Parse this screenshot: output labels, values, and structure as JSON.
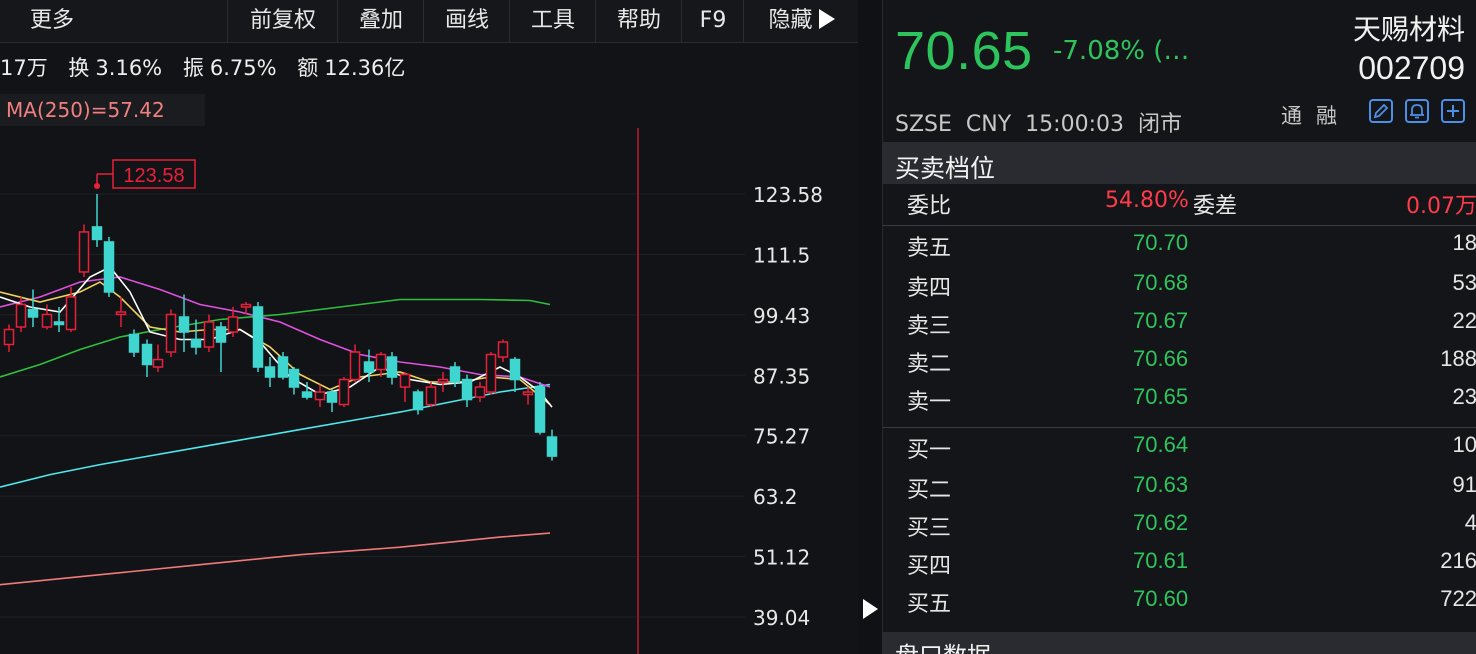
{
  "toolbar": {
    "items": [
      "更多",
      "前复权",
      "叠加",
      "画线",
      "工具",
      "帮助",
      "F9",
      "隐藏"
    ]
  },
  "stats": {
    "volume_value": "17万",
    "turnover_label": "换",
    "turnover_value": "3.16%",
    "amplitude_label": "振",
    "amplitude_value": "6.75%",
    "amount_label": "额",
    "amount_value": "12.36亿"
  },
  "ma_legend": "MA(250)=57.42",
  "chart": {
    "y_ticks": [
      "123.58",
      "111.5",
      "99.43",
      "87.35",
      "75.27",
      "63.2",
      "51.12",
      "39.04"
    ],
    "high_marker": "123.58",
    "colors": {
      "up": "#e8203a",
      "down": "#3fd6d0",
      "ma5": "#ffffff",
      "ma10": "#f0d25a",
      "ma20": "#e050e0",
      "ma60": "#2fbf3f",
      "ma120": "#4fe8ee",
      "ma250": "#f07a7a",
      "cursor": "#9b1c24"
    }
  },
  "quote": {
    "price": "70.65",
    "change": "-7.08%  (…",
    "name": "天赐材料",
    "code": "002709",
    "exchange": "SZSE",
    "currency": "CNY",
    "time": "15:00:03",
    "status": "闭市",
    "tags": [
      "通",
      "融"
    ],
    "icons": [
      "edit-icon",
      "bell-icon",
      "add-icon"
    ]
  },
  "orderbook": {
    "title": "买卖档位",
    "ratio_label": "委比",
    "ratio_value": "54.80%",
    "diff_label": "委差",
    "diff_value": "0.07万",
    "asks": [
      {
        "label": "卖五",
        "price": "70.70",
        "vol": "18"
      },
      {
        "label": "卖四",
        "price": "70.68",
        "vol": "53"
      },
      {
        "label": "卖三",
        "price": "70.67",
        "vol": "22"
      },
      {
        "label": "卖二",
        "price": "70.66",
        "vol": "188"
      },
      {
        "label": "卖一",
        "price": "70.65",
        "vol": "23"
      }
    ],
    "bids": [
      {
        "label": "买一",
        "price": "70.64",
        "vol": "10"
      },
      {
        "label": "买二",
        "price": "70.63",
        "vol": "91"
      },
      {
        "label": "买三",
        "price": "70.62",
        "vol": "4"
      },
      {
        "label": "买四",
        "price": "70.61",
        "vol": "216"
      },
      {
        "label": "买五",
        "price": "70.60",
        "vol": "722"
      }
    ]
  },
  "next_section": "盘口数据"
}
